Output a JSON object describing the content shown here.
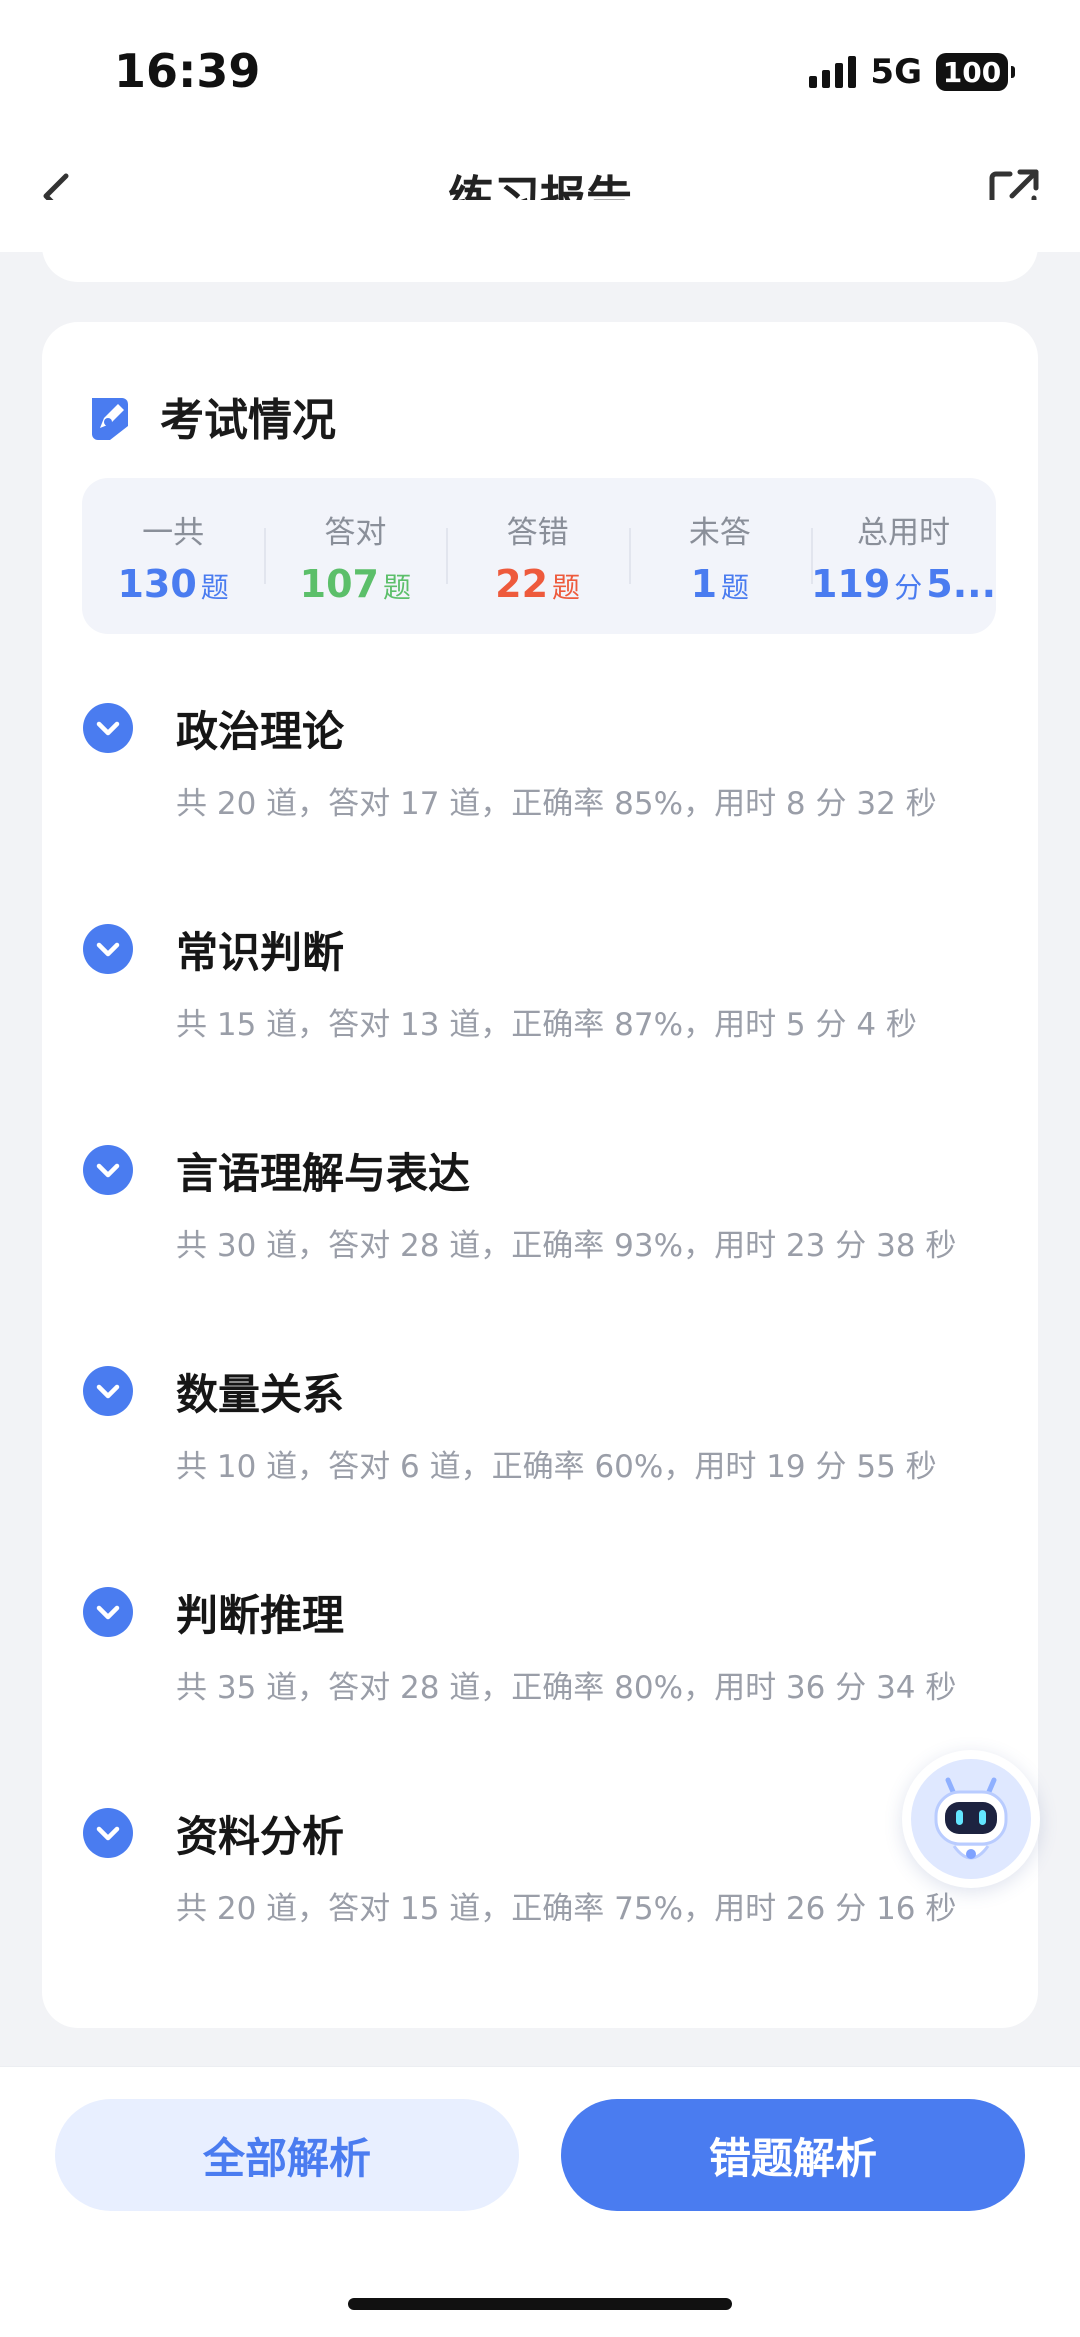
{
  "status_bar": {
    "time": "16:39",
    "network": "5G",
    "battery": "100"
  },
  "nav": {
    "title": "练习报告"
  },
  "exam": {
    "title": "考试情况",
    "stats": [
      {
        "label": "一共",
        "value": "130",
        "unit": "题",
        "color": "#4a7cf0"
      },
      {
        "label": "答对",
        "value": "107",
        "unit": "题",
        "color": "#5cbf6a"
      },
      {
        "label": "答错",
        "value": "22",
        "unit": "题",
        "color": "#ee5a3c"
      },
      {
        "label": "未答",
        "value": "1",
        "unit": "题",
        "color": "#4a7cf0"
      },
      {
        "label": "总用时",
        "value": "119",
        "unit": "分",
        "extra": "5...",
        "color": "#4a7cf0"
      }
    ]
  },
  "sections": [
    {
      "name": "政治理论",
      "detail": "共 20 道，答对 17 道，正确率 85%，用时 8 分 32 秒"
    },
    {
      "name": "常识判断",
      "detail": "共 15 道，答对 13 道，正确率 87%，用时 5 分 4 秒"
    },
    {
      "name": "言语理解与表达",
      "detail": "共 30 道，答对 28 道，正确率 93%，用时 23 分 38 秒"
    },
    {
      "name": "数量关系",
      "detail": "共 10 道，答对 6 道，正确率 60%，用时 19 分 55 秒"
    },
    {
      "name": "判断推理",
      "detail": "共 35 道，答对 28 道，正确率 80%，用时 36 分 34 秒"
    },
    {
      "name": "资料分析",
      "detail": "共 20 道，答对 15 道，正确率 75%，用时 26 分 16 秒"
    }
  ],
  "actions": {
    "all_analysis": "全部解析",
    "wrong_analysis": "错题解析"
  },
  "icons": {
    "back": "chevron-left-icon",
    "share": "share-icon",
    "exam": "pencil-badge-icon",
    "section": "chevron-down-circle-icon",
    "assistant": "robot-icon"
  },
  "colors": {
    "accent": "#4a7cf0",
    "correct": "#5cbf6a",
    "wrong": "#ee5a3c"
  }
}
